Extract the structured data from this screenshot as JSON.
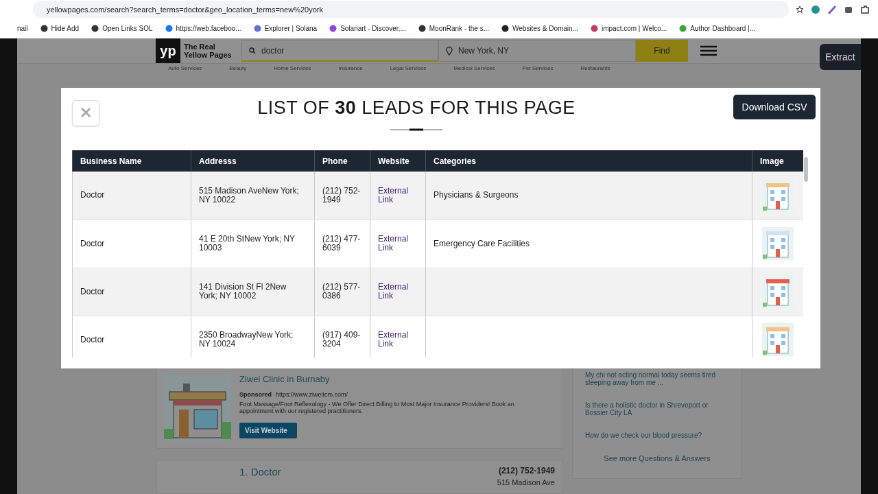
{
  "browser": {
    "url": "yellowpages.com/search?search_terms=doctor&geo_location_terms=new%20york",
    "bookmarks": [
      {
        "label": "nail"
      },
      {
        "label": "Hide Add"
      },
      {
        "label": "Open Links SOL"
      },
      {
        "label": "https://web.faceboo..."
      },
      {
        "label": "Explorer | Solana"
      },
      {
        "label": "Solanart - Discover,..."
      },
      {
        "label": "MoonRank - the s..."
      },
      {
        "label": "Websites & Domain..."
      },
      {
        "label": "impact.com | Welco..."
      },
      {
        "label": "Author Dashboard |..."
      }
    ]
  },
  "header": {
    "logo": "yp",
    "brand_line_1": "The Real",
    "brand_line_2": "Yellow Pages",
    "search": "doctor",
    "location": "New York, NY",
    "find": "Find",
    "extract": "Extract"
  },
  "categories": [
    "Auto Services",
    "Beauty",
    "Home Services",
    "Insurance",
    "Legal Services",
    "Medical Services",
    "Pet Services",
    "Restaurants"
  ],
  "modal": {
    "close": "✕",
    "title": "LIST OF **30** LEADS FOR THIS PAGE",
    "download": "Download CSV",
    "columns": [
      "Business Name",
      "Addresss",
      "Phone",
      "Website",
      "Categories",
      "Image"
    ],
    "rows": [
      {
        "name": "Doctor",
        "address": "515 Madison AveNew York; NY 10022",
        "phone": "(212) 752-1949",
        "website": "External Link",
        "categories": "Physicians & Surgeons"
      },
      {
        "name": "Doctor",
        "address": "41 E 20th StNew York; NY 10003",
        "phone": "(212) 477-6039",
        "website": "External Link",
        "categories": "Emergency Care Facilities"
      },
      {
        "name": "Doctor",
        "address": "141 Division St Fl 2New York; NY 10002",
        "phone": "(212) 577-0386",
        "website": "External Link"
      },
      {
        "name": "Doctor",
        "address": "2350 BroadwayNew York; NY 10024",
        "phone": "(917) 409-3204",
        "website": "External Link"
      }
    ]
  },
  "ad": {
    "title": "Ziwei Clinic in Burnaby",
    "sponsored": "Sponsored",
    "url": "https://www.ziweitcm.com/",
    "description": "Foot Massage/Foot Reflexology - We Offer Direct Billing to Most Major Insurance Providers! Book an appointment with our registered practitioners.",
    "button": "Visit Website"
  },
  "listing": {
    "title": "1. Doctor",
    "phone": "(212) 752-1949",
    "address": "515 Madison Ave"
  },
  "questions": [
    "My chi not acting normal today seems tired sleeping away from me ...",
    "Is there a holistic doctor in Shreveport or Bossier City LA",
    "How do we check our blood pressure?"
  ],
  "see_more": "See more Questions & Answers"
}
